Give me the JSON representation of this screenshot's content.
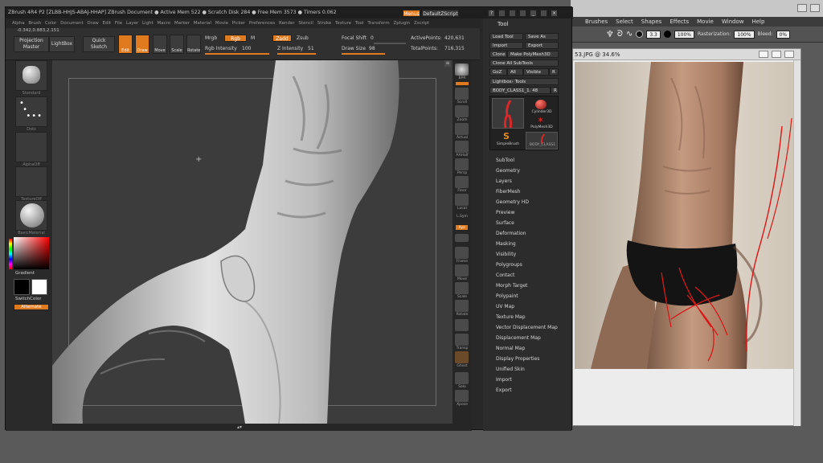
{
  "zbrush": {
    "title": "ZBrush 4R4 P2 [ZLBB-HHJS-ABAJ-HHAP]   ZBrush Document   ● Active Mem 522 ● Scratch Disk 284 ● Free Mem 3573 ● Timers 0.062",
    "menus_btn": "Menus",
    "script_btn": "DefaultZScript",
    "menu_items": [
      "Alpha",
      "Brush",
      "Color",
      "Document",
      "Draw",
      "Edit",
      "File",
      "Layer",
      "Light",
      "Macro",
      "Marker",
      "Material",
      "Movie",
      "Picker",
      "Preferences",
      "Render",
      "Stencil",
      "Stroke",
      "Texture",
      "Tool",
      "Transform",
      "Zplugin",
      "Zscript"
    ],
    "coords": "-0.342,0.883,2.151",
    "top": {
      "projection_master": "Projection\nMaster",
      "lightbox": "LightBox",
      "quick_sketch": "Quick\nSketch",
      "edit": "Edit",
      "draw": "Draw",
      "move": "Move",
      "scale": "Scale",
      "rotate": "Rotate",
      "mrgb": "Mrgb",
      "rgb": "Rgb",
      "m": "M",
      "rgb_intensity_label": "Rgb Intensity",
      "rgb_intensity": "100",
      "zadd": "Zadd",
      "zsub": "Zsub",
      "z_intensity_label": "Z Intensity",
      "z_intensity": "51",
      "focal_shift_label": "Focal Shift",
      "focal_shift": "0",
      "draw_size_label": "Draw Size",
      "draw_size": "98",
      "active_points_label": "ActivePoints:",
      "active_points": "420,631",
      "total_points_label": "TotalPoints:",
      "total_points": "716,315"
    },
    "left": {
      "thumbs": [
        "Standard",
        "Dots",
        "",
        "AlphaOff",
        "TextureOff",
        "BasicMaterial"
      ],
      "gradient": "Gradient",
      "switch_color": "SwitchColor",
      "alternate": "Alternate"
    },
    "shelf": [
      "BPR",
      "SPix",
      "Scroll",
      "Zoom",
      "Actual",
      "AAHalf",
      "Persp",
      "Floor",
      "Local",
      "L.Sym",
      "Xyz",
      "",
      "Frame",
      "Move",
      "Scale",
      "Rotate",
      "Transp",
      "Ghost",
      "Solo",
      "Xpose"
    ],
    "tool_panel": {
      "title": "Tool",
      "load_tool": "Load Tool",
      "save_as": "Save As",
      "import": "Import",
      "export": "Export",
      "clone": "Clone",
      "make_polymesh": "Make PolyMesh3D",
      "clone_all": "Clone All SubTools",
      "goz": "GoZ",
      "all": "All",
      "visible": "Visible",
      "r": "R",
      "lightbox_tools": "Lightbox› Tools",
      "current_tool": "BODY_CLASS1_1. 48",
      "tool_r": "R",
      "thumb_labels": [
        "",
        "Cylinder3D",
        "PolyMesh3D",
        "SimpleBrush",
        "BODY_CLASS1"
      ],
      "sections": [
        "SubTool",
        "Geometry",
        "Layers",
        "FiberMesh",
        "Geometry HD",
        "Preview",
        "Surface",
        "Deformation",
        "Masking",
        "Visibility",
        "Polygroups",
        "Contact",
        "Morph Target",
        "Polypaint",
        "UV Map",
        "Texture Map",
        "Vector Displacement Map",
        "Displacement Map",
        "Normal Map",
        "Display Properties",
        "Unified Skin",
        "Import",
        "Export"
      ]
    }
  },
  "photoshop": {
    "menu_items": [
      "Brushes",
      "Select",
      "Shapes",
      "Effects",
      "Movie",
      "Window",
      "Help"
    ],
    "opts": {
      "size": "3.3",
      "zoom": "100%",
      "rasterization_label": "Rasterization:",
      "rasterization": "100%",
      "bleed_label": "Bleed:",
      "bleed": "0%"
    },
    "doc_title": "53.JPG @ 34.6%"
  },
  "colors": {
    "accent": "#e07a1e",
    "zb_bg": "#282828",
    "photo_red": "#d81818"
  }
}
